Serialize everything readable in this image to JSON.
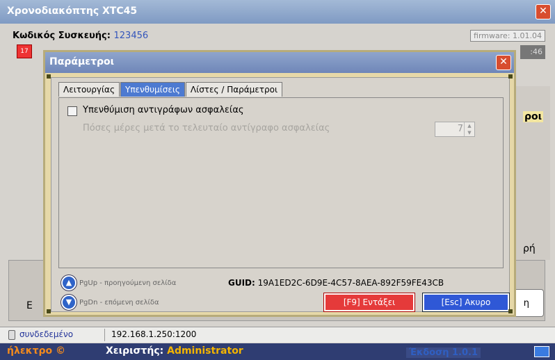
{
  "main_window": {
    "title": "Χρονοδιακόπτης XTC45",
    "close_label": "✕",
    "device_label": "Κωδικός Συσκευής:",
    "device_code": "123456",
    "firmware": "firmware: 1.01.04",
    "firmware_sub": ":46",
    "calendar_icon_text": "17",
    "side_labels": [
      "ροι",
      "ρή"
    ],
    "left_partial": "Ε",
    "right_button_partial": "η"
  },
  "dialog": {
    "title": "Παράμετροι",
    "close_label": "✕",
    "tabs": [
      {
        "label": "Λειτουργίας",
        "active": false
      },
      {
        "label": "Υπενθυμίσεις",
        "active": true
      },
      {
        "label": "Λίστες / Παράμετροι",
        "active": false
      }
    ],
    "reminder_checkbox_label": "Υπενθύμιση αντιγράφων ασφαλείας",
    "reminder_checked": false,
    "days_label": "Πόσες μέρες μετά το τελευταίο αντίγραφο ασφαλείας",
    "days_value": "7",
    "pgup_hint": "PgUp - προηγούμενη σελίδα",
    "pgdn_hint": "PgDn - επόμενη σελίδα",
    "guid_label": "GUID:",
    "guid_value": "19A1ED2C-6D9E-4C57-8AEA-892F59FE43CB",
    "ok_button": "[F9] Εντάξει",
    "cancel_button": "[Esc] Ακυρο"
  },
  "status": {
    "connection": "συνδεδεμένο",
    "ip": "192.168.1.250:1200"
  },
  "bottom_bar": {
    "brand": "ήλεκτρο ©",
    "operator_label": "Χειριστής:",
    "operator_value": "Administrator",
    "version": "Έκδοση 1.0.1"
  },
  "colors": {
    "active_tab": "#4d7ad1",
    "ok_button": "#e53a3a",
    "cancel_button": "#2f58d6",
    "bottom_bar": "#2f3d72",
    "brand": "#f28a1d"
  }
}
